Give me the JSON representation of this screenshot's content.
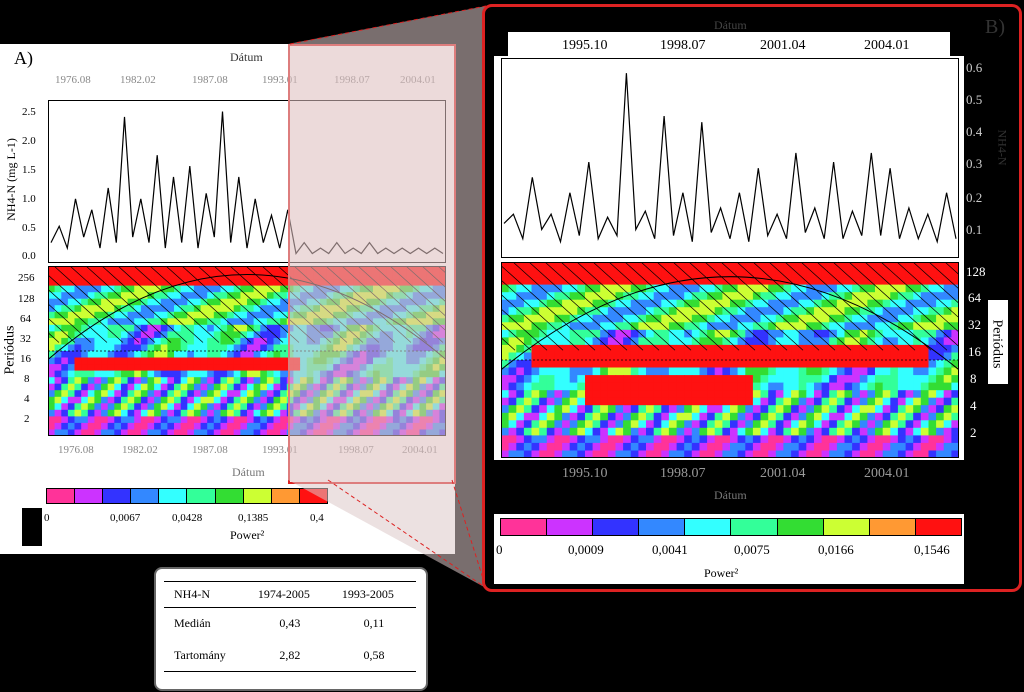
{
  "panel_a": {
    "letter": "A)",
    "top_axis_label": "Dátum",
    "bottom_axis_label": "Dátum",
    "x_ticks": [
      "1976.08",
      "1982.02",
      "1987.08",
      "1993.01",
      "1998.07",
      "2004.01"
    ],
    "ts_ylabel": "NH4-N (mg L-1)",
    "ts_yticks": [
      "2.5",
      "2.0",
      "1.5",
      "1.0",
      "0.5",
      "0.0"
    ],
    "wavelet_ylabel": "Periódus",
    "wavelet_yticks": [
      "256",
      "128",
      "64",
      "32",
      "16",
      "8",
      "4",
      "2"
    ],
    "colorbar_ticks": [
      "0",
      "0,0067",
      "0,0428",
      "0,1385",
      "0,4"
    ],
    "colorbar_label": "Power²"
  },
  "panel_b": {
    "letter": "B)",
    "top_axis_label": "Dátum",
    "bottom_axis_label": "Dátum",
    "x_ticks": [
      "1995.10",
      "1998.07",
      "2001.04",
      "2004.01"
    ],
    "ts_ylabel": "NH4-N",
    "ts_yticks": [
      "0.6",
      "0.5",
      "0.4",
      "0.3",
      "0.2",
      "0.1"
    ],
    "wavelet_ylabel": "Periódus",
    "wavelet_yticks": [
      "128",
      "64",
      "32",
      "16",
      "8",
      "4",
      "2"
    ],
    "colorbar_ticks": [
      "0",
      "0,0009",
      "0,0041",
      "0,0075",
      "0,0166",
      "0,1546"
    ],
    "colorbar_label": "Power²"
  },
  "colors": {
    "palette": [
      "#ff3399",
      "#cc33ff",
      "#3333ff",
      "#3388ff",
      "#33ffff",
      "#33ff99",
      "#33dd33",
      "#ccff33",
      "#ff9933",
      "#ff1111"
    ],
    "highlight": "#dd2222"
  },
  "stats_table": {
    "header": [
      "NH4-N",
      "1974-2005",
      "1993-2005"
    ],
    "rows": [
      {
        "label": "Medián",
        "v1": "0,43",
        "v2": "0,11"
      },
      {
        "label": "Tartomány",
        "v1": "2,82",
        "v2": "0,58"
      }
    ]
  },
  "chart_data": [
    {
      "type": "line",
      "title": "",
      "xlabel": "Dátum",
      "ylabel": "NH4-N (mg L-1)",
      "x_range": [
        "1974",
        "2005"
      ],
      "ylim": [
        0,
        2.8
      ],
      "series": [
        {
          "values": [
            0.3,
            0.6,
            0.2,
            1.1,
            0.4,
            0.9,
            0.2,
            1.3,
            0.3,
            2.6,
            0.4,
            1.1,
            0.3,
            1.9,
            0.2,
            1.5,
            0.3,
            1.7,
            0.2,
            1.2,
            0.4,
            2.7,
            0.3,
            1.5,
            0.2,
            1.1,
            0.3,
            0.8,
            0.2,
            0.9,
            0.1,
            0.3,
            0.1,
            0.2,
            0.1,
            0.3,
            0.1,
            0.2,
            0.1,
            0.3,
            0.1,
            0.2,
            0.1,
            0.2,
            0.1,
            0.2,
            0.1,
            0.2,
            0.1
          ]
        }
      ]
    },
    {
      "type": "line",
      "title": "",
      "xlabel": "Dátum",
      "ylabel": "NH4-N",
      "x_range": [
        "1993",
        "2005"
      ],
      "ylim": [
        0,
        0.62
      ],
      "series": [
        {
          "values": [
            0.1,
            0.13,
            0.05,
            0.25,
            0.08,
            0.13,
            0.04,
            0.2,
            0.06,
            0.3,
            0.05,
            0.12,
            0.06,
            0.59,
            0.08,
            0.14,
            0.05,
            0.45,
            0.06,
            0.2,
            0.04,
            0.43,
            0.07,
            0.15,
            0.05,
            0.2,
            0.04,
            0.28,
            0.06,
            0.13,
            0.05,
            0.33,
            0.07,
            0.15,
            0.05,
            0.3,
            0.05,
            0.14,
            0.06,
            0.33,
            0.06,
            0.28,
            0.05,
            0.15,
            0.05,
            0.13,
            0.04,
            0.2,
            0.05
          ]
        }
      ]
    }
  ]
}
